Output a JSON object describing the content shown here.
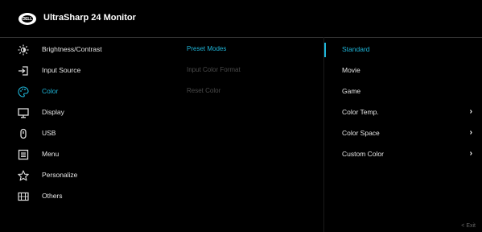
{
  "header": {
    "logo_text": "DELL",
    "title": "UltraSharp 24 Monitor"
  },
  "menu": [
    {
      "label": "Brightness/Contrast",
      "icon": "brightness-icon",
      "active": false
    },
    {
      "label": "Input Source",
      "icon": "input-source-icon",
      "active": false
    },
    {
      "label": "Color",
      "icon": "color-palette-icon",
      "active": true
    },
    {
      "label": "Display",
      "icon": "display-icon",
      "active": false
    },
    {
      "label": "USB",
      "icon": "usb-icon",
      "active": false
    },
    {
      "label": "Menu",
      "icon": "menu-icon",
      "active": false
    },
    {
      "label": "Personalize",
      "icon": "star-icon",
      "active": false
    },
    {
      "label": "Others",
      "icon": "others-icon",
      "active": false
    }
  ],
  "submenu": [
    {
      "label": "Preset Modes",
      "active": true
    },
    {
      "label": "Input Color Format",
      "active": false
    },
    {
      "label": "Reset Color",
      "active": false
    }
  ],
  "options": [
    {
      "label": "Standard",
      "active": true,
      "has_arrow": false
    },
    {
      "label": "Movie",
      "active": false,
      "has_arrow": false
    },
    {
      "label": "Game",
      "active": false,
      "has_arrow": false
    },
    {
      "label": "Color Temp.",
      "active": false,
      "has_arrow": true
    },
    {
      "label": "Color Space",
      "active": false,
      "has_arrow": true
    },
    {
      "label": "Custom Color",
      "active": false,
      "has_arrow": true
    }
  ],
  "footer": {
    "exit_label": "< Exit"
  },
  "colors": {
    "accent": "#1fb6d9",
    "background": "#000000"
  }
}
